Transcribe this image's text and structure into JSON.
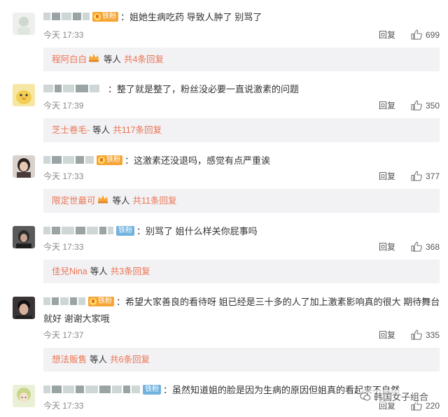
{
  "comments": [
    {
      "badge": "fan",
      "badge_label": "铁粉",
      "text": "：姐她生病吃药 导致人肿了 别骂了",
      "time": "今天 17:33",
      "reply": "回复",
      "likes": "699",
      "replies": {
        "who": "程阿白白",
        "crown": true,
        "mid": "等人",
        "count": "共4条回复"
      }
    },
    {
      "badge": "none",
      "badge_label": "",
      "text": "：整了就是整了，粉丝没必要一直说激素的问题",
      "time": "今天 17:39",
      "reply": "回复",
      "likes": "350",
      "replies": {
        "who": "芝士卷毛-",
        "crown": false,
        "mid": "等人",
        "count": "共117条回复"
      }
    },
    {
      "badge": "fan",
      "badge_label": "铁粉",
      "text": "：这激素还没退吗，感觉有点严重诶",
      "time": "今天 17:33",
      "reply": "回复",
      "likes": "377",
      "replies": {
        "who": "限定世最可",
        "crown": true,
        "mid": "等人",
        "count": "共11条回复"
      }
    },
    {
      "badge": "iron",
      "badge_label": "铁粉",
      "text": "：别骂了 姐什么样关你屁事吗",
      "time": "今天 17:33",
      "reply": "回复",
      "likes": "368",
      "replies": {
        "who": "佳兒Nina",
        "crown": false,
        "mid": "等人",
        "count": "共3条回复"
      }
    },
    {
      "badge": "fan",
      "badge_label": "铁粉",
      "text": "：希望大家善良的看待呀 姐已经是三十多的人了加上激素影响真的很大 期待舞台",
      "text2": "就好 谢谢大家哦",
      "time": "今天 17:37",
      "reply": "回复",
      "likes": "335",
      "replies": {
        "who": "想法贩售",
        "crown": false,
        "mid": "等人",
        "count": "共6条回复"
      }
    },
    {
      "badge": "iron",
      "badge_label": "铁粉",
      "text": "：虽然知道姐的脸是因为生病的原因但姐真的看起来不自然",
      "time": "今天 17:33",
      "reply": "回复",
      "likes": "220"
    }
  ],
  "watermark": "韩国女子组合",
  "colors": {
    "link": "#eb7350",
    "fan_badge": "#f7a536",
    "iron_badge": "#71b3df",
    "reply_bg": "#f2f2f5"
  }
}
